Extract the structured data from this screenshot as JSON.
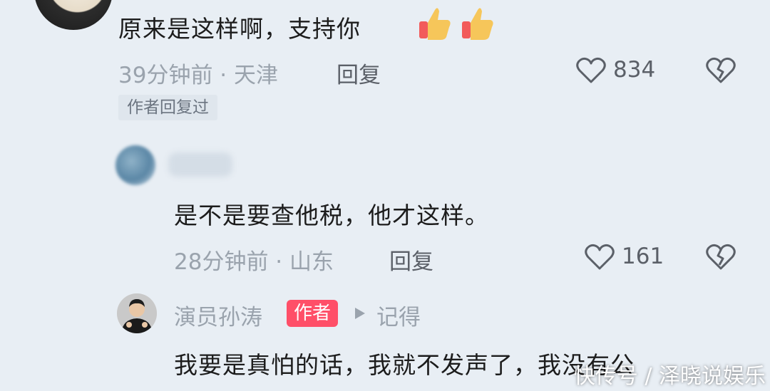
{
  "comments": [
    {
      "text": "原来是这样啊，支持你",
      "emoji": [
        "thumbs-up-icon",
        "thumbs-up-icon"
      ],
      "time_location": "39分钟前 · 天津",
      "reply_label": "回复",
      "like_count": "834",
      "tag": "作者回复过"
    },
    {
      "text": "是不是要查他税，他才这样。",
      "time_location": "28分钟前 · 山东",
      "reply_label": "回复",
      "like_count": "161"
    },
    {
      "username": "演员孙涛",
      "badge": "作者",
      "reply_to": "记得",
      "text": "我要是真怕的话，我就不发声了，我没有公"
    }
  ],
  "watermark": "快传号 / 泽晓说娱乐",
  "colors": {
    "background": "#e8eef4",
    "author_badge": "#ff4f68",
    "meta_text": "#9aa3ad"
  }
}
